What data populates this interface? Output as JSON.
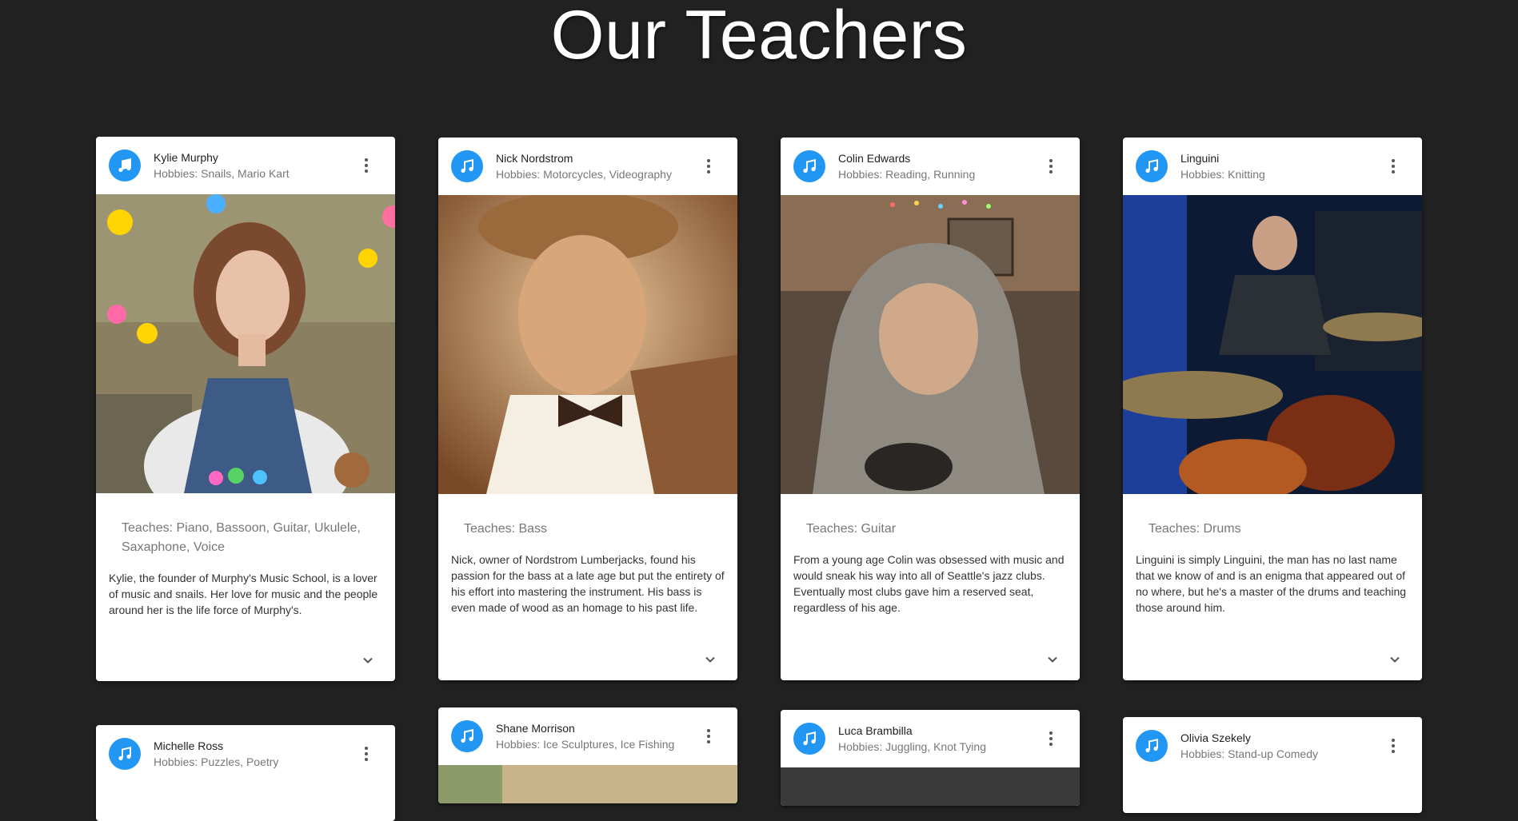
{
  "page": {
    "title": "Our Teachers"
  },
  "teachers": [
    {
      "name": "Kylie Murphy",
      "hobbies": "Hobbies: Snails, Mario Kart",
      "teaches": "Teaches: Piano, Bassoon, Guitar, Ukulele, Saxaphone, Voice",
      "bio": "Kylie, the founder of Murphy's Music School, is a lover of music and snails. Her love for music and the people around her is the life force of Murphy's.",
      "photo_icon": "portrait-photo"
    },
    {
      "name": "Nick Nordstrom",
      "hobbies": "Hobbies: Motorcycles, Videography",
      "teaches": "Teaches: Bass",
      "bio": "Nick, owner of Nordstrom Lumberjacks, found his passion for the bass at a late age but put the entirety of his effort into mastering the instrument. His bass is even made of wood as an homage to his past life.",
      "photo_icon": "portrait-photo"
    },
    {
      "name": "Colin Edwards",
      "hobbies": "Hobbies: Reading, Running",
      "teaches": "Teaches: Guitar",
      "bio": "From a young age Colin was obsessed with music and would sneak his way into all of Seattle's jazz clubs. Eventually most clubs gave him a reserved seat, regardless of his age.",
      "photo_icon": "portrait-photo"
    },
    {
      "name": "Linguini",
      "hobbies": "Hobbies: Knitting",
      "teaches": "Teaches: Drums",
      "bio": "Linguini is simply Linguini, the man has no last name that we know of and is an enigma that appeared out of no where, but he's a master of the drums and teaching those around him.",
      "photo_icon": "portrait-photo"
    },
    {
      "name": "Michelle Ross",
      "hobbies": "Hobbies: Puzzles, Poetry"
    },
    {
      "name": "Shane Morrison",
      "hobbies": "Hobbies: Ice Sculptures, Ice Fishing"
    },
    {
      "name": "Luca Brambilla",
      "hobbies": "Hobbies: Juggling, Knot Tying"
    },
    {
      "name": "Olivia Szekely",
      "hobbies": "Hobbies: Stand-up Comedy"
    }
  ],
  "colors": {
    "background": "#212121",
    "avatar": "#2196f3",
    "card": "#ffffff"
  },
  "icons": {
    "avatar": "music-note-icon",
    "menu": "more-vert-icon",
    "expand": "chevron-down-icon"
  }
}
